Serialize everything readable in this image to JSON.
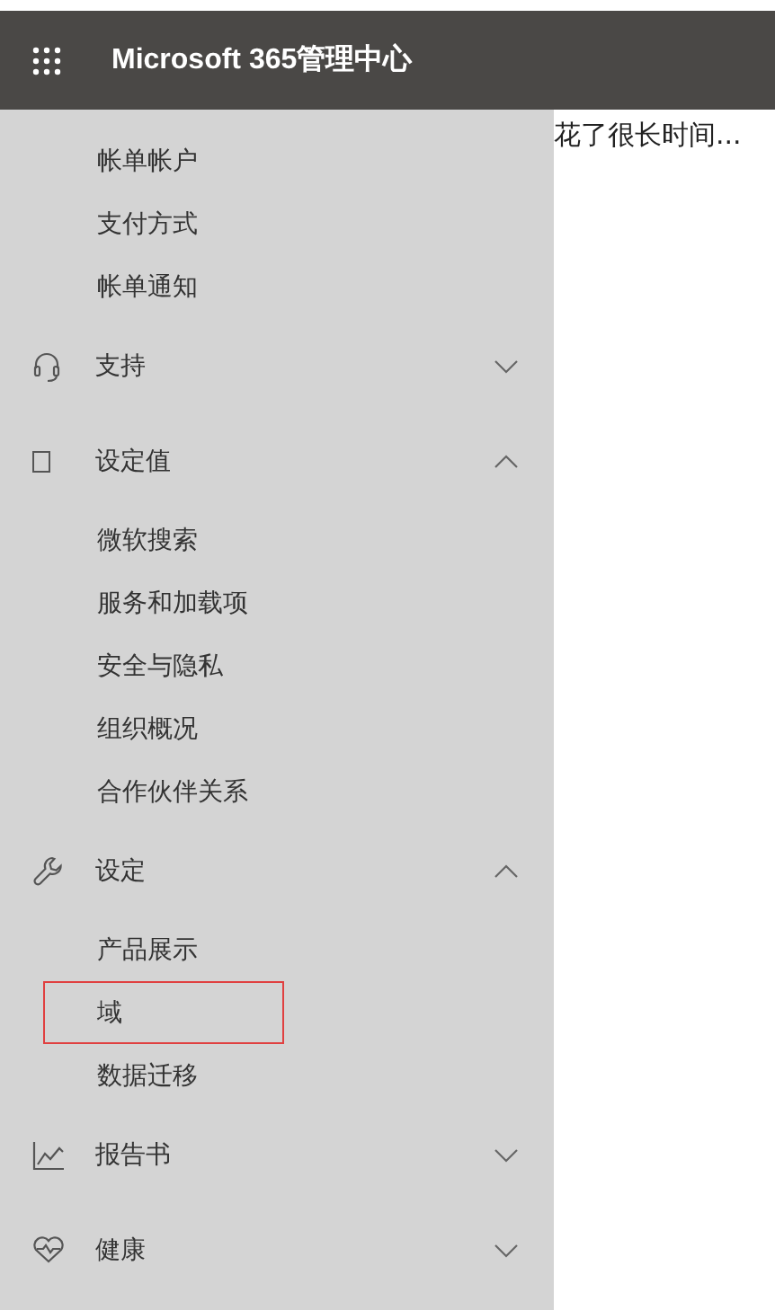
{
  "header": {
    "title": "Microsoft 365管理中心"
  },
  "nav": [
    {
      "kind": "sub",
      "label": "帐单帐户",
      "selected": false
    },
    {
      "kind": "sub",
      "label": "支付方式",
      "selected": false
    },
    {
      "kind": "sub",
      "label": "帐单通知",
      "selected": false
    },
    {
      "kind": "group",
      "label": "支持",
      "expanded": false
    },
    {
      "kind": "group",
      "label": "设定值",
      "expanded": true,
      "children": [
        {
          "label": "微软搜索",
          "selected": false
        },
        {
          "label": "服务和加载项",
          "selected": false
        },
        {
          "label": "安全与隐私",
          "selected": false
        },
        {
          "label": "组织概况",
          "selected": false
        },
        {
          "label": "合作伙伴关系",
          "selected": false
        }
      ]
    },
    {
      "kind": "group",
      "label": "设定",
      "expanded": true,
      "children": [
        {
          "label": "产品展示",
          "selected": false
        },
        {
          "label": "域",
          "selected": true
        },
        {
          "label": "数据迁移",
          "selected": false
        }
      ]
    },
    {
      "kind": "group",
      "label": "报告书",
      "expanded": false
    },
    {
      "kind": "group",
      "label": "健康",
      "expanded": false
    }
  ],
  "main": {
    "loading_text": "花了很长时间..."
  }
}
